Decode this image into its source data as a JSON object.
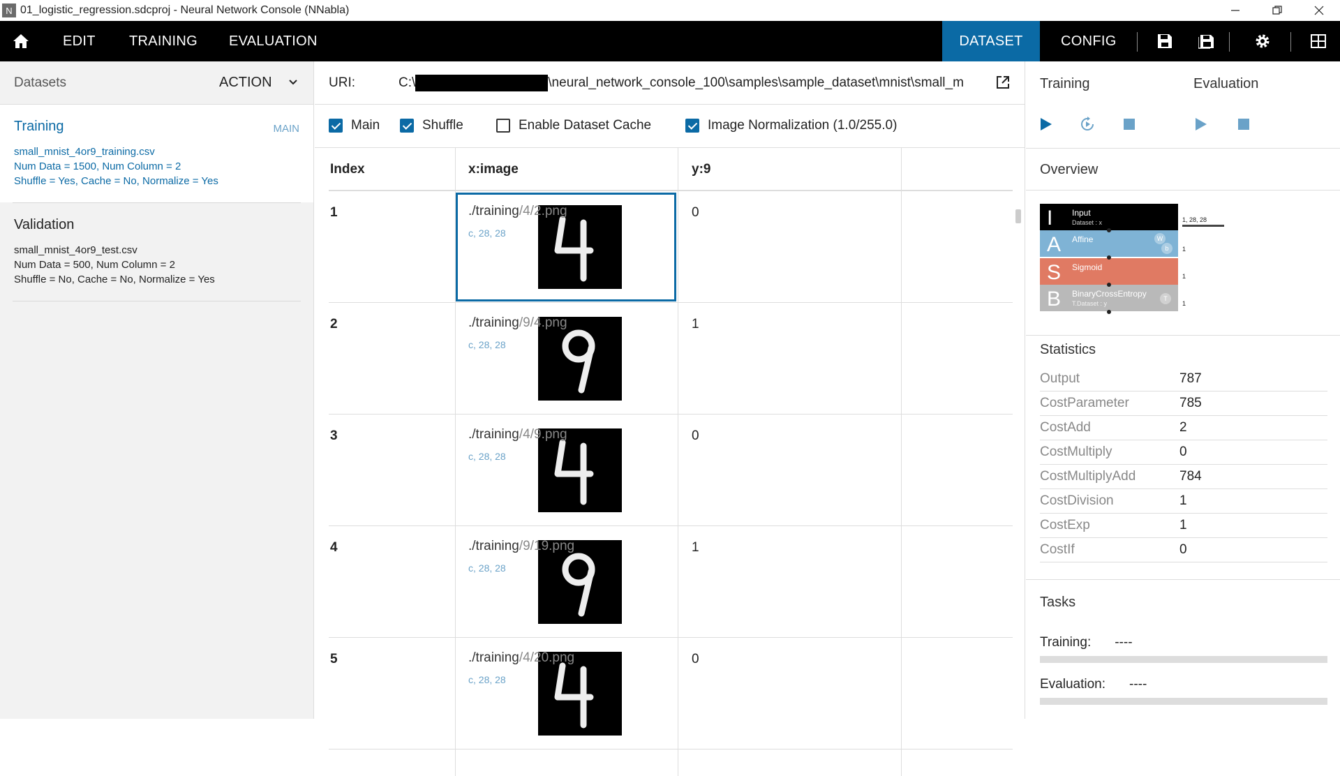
{
  "window": {
    "app_icon": "N",
    "title": "01_logistic_regression.sdcproj - Neural Network Console (NNabla)"
  },
  "menu": {
    "home_icon": "home-icon",
    "edit": "EDIT",
    "training": "TRAINING",
    "evaluation": "EVALUATION",
    "dataset": "DATASET",
    "config": "CONFIG"
  },
  "left": {
    "header": "Datasets",
    "action": "ACTION",
    "datasets": [
      {
        "name": "Training",
        "tag": "MAIN",
        "file": "small_mnist_4or9_training.csv",
        "info": "Num Data = 1500, Num Column = 2",
        "flags": "Shuffle = Yes, Cache = No, Normalize = Yes"
      },
      {
        "name": "Validation",
        "file": "small_mnist_4or9_test.csv",
        "info": "Num Data = 500, Num Column = 2",
        "flags": "Shuffle = No, Cache = No, Normalize = Yes"
      }
    ]
  },
  "center": {
    "uri_label": "URI:",
    "uri_prefix": "C:\\",
    "uri_suffix": "\\neural_network_console_100\\samples\\sample_dataset\\mnist\\small_m",
    "options": {
      "main": "Main",
      "shuffle": "Shuffle",
      "cache": "Enable Dataset Cache",
      "normalization": "Image Normalization (1.0/255.0)"
    },
    "columns": [
      "Index",
      "x:image",
      "y:9"
    ],
    "rows": [
      {
        "index": "1",
        "path": "./training",
        "path_rest": "/4/2.png",
        "shape": "c, 28, 28",
        "y": "0",
        "digit": "4"
      },
      {
        "index": "2",
        "path": "./training",
        "path_rest": "/9/4.png",
        "shape": "c, 28, 28",
        "y": "1",
        "digit": "9"
      },
      {
        "index": "3",
        "path": "./training",
        "path_rest": "/4/9.png",
        "shape": "c, 28, 28",
        "y": "0",
        "digit": "4"
      },
      {
        "index": "4",
        "path": "./training",
        "path_rest": "/9/19.png",
        "shape": "c, 28, 28",
        "y": "1",
        "digit": "9"
      },
      {
        "index": "5",
        "path": "./training",
        "path_rest": "/4/20.png",
        "shape": "c, 28, 28",
        "y": "0",
        "digit": "4"
      }
    ]
  },
  "right": {
    "training": "Training",
    "evaluation": "Evaluation",
    "overview": "Overview",
    "network": {
      "layers": [
        {
          "letter": "I",
          "name": "Input",
          "sub": "Dataset : x",
          "color": "#000000",
          "dim": "1, 28, 28"
        },
        {
          "letter": "A",
          "name": "Affine",
          "sub": "",
          "color": "#7fb3d5",
          "dim": "1"
        },
        {
          "letter": "S",
          "name": "Sigmoid",
          "sub": "",
          "color": "#e07a63",
          "dim": "1"
        },
        {
          "letter": "B",
          "name": "BinaryCrossEntropy",
          "sub": "T.Dataset : y",
          "color": "#b9b9b9",
          "dim": "1"
        }
      ],
      "affine_params": [
        "W",
        "b"
      ],
      "bce_param": "T"
    },
    "statistics_title": "Statistics",
    "statistics": [
      {
        "k": "Output",
        "v": "787"
      },
      {
        "k": "CostParameter",
        "v": "785"
      },
      {
        "k": "CostAdd",
        "v": "2"
      },
      {
        "k": "CostMultiply",
        "v": "0"
      },
      {
        "k": "CostMultiplyAdd",
        "v": "784"
      },
      {
        "k": "CostDivision",
        "v": "1"
      },
      {
        "k": "CostExp",
        "v": "1"
      },
      {
        "k": "CostIf",
        "v": "0"
      }
    ],
    "tasks_title": "Tasks",
    "tasks": [
      {
        "label": "Training:",
        "value": "----"
      },
      {
        "label": "Evaluation:",
        "value": "----"
      }
    ]
  }
}
